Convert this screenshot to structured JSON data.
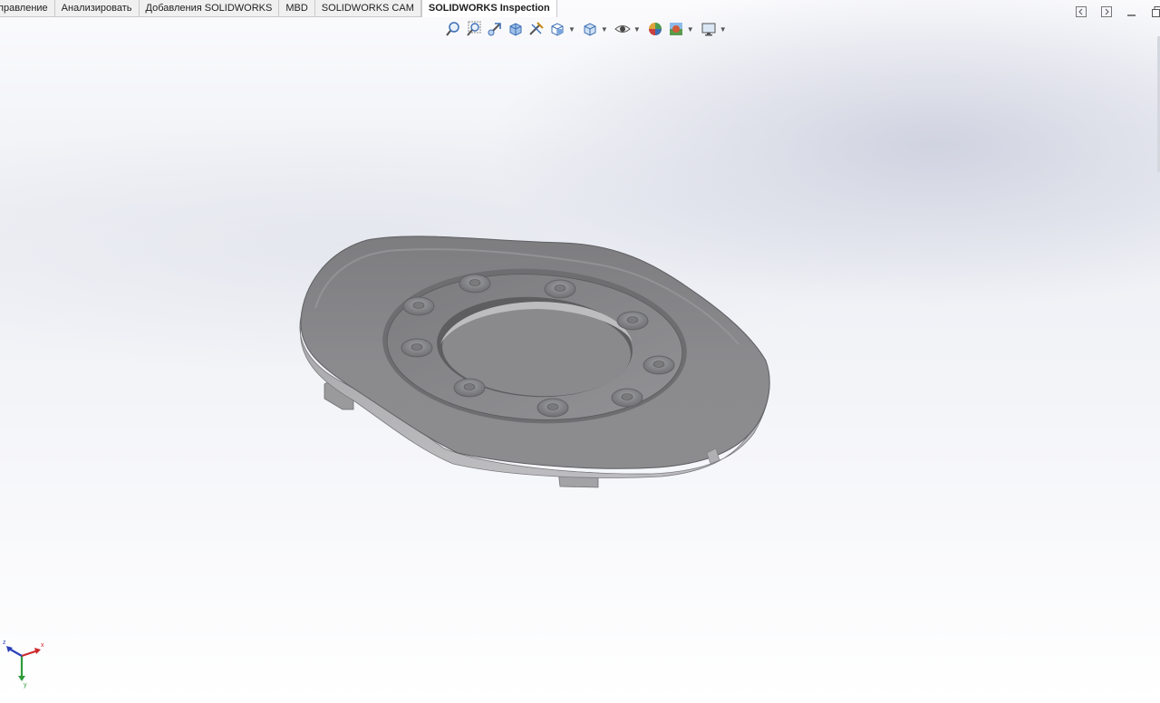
{
  "tabs": [
    {
      "label": "правление",
      "active": false
    },
    {
      "label": "Анализировать",
      "active": false
    },
    {
      "label": "Добавления SOLIDWORKS",
      "active": false
    },
    {
      "label": "MBD",
      "active": false
    },
    {
      "label": "SOLIDWORKS CAM",
      "active": false
    },
    {
      "label": "SOLIDWORKS Inspection",
      "active": true
    }
  ],
  "heads_up_toolbar": {
    "icons": [
      "zoom-to-fit-icon",
      "zoom-to-area-icon",
      "previous-view-icon",
      "section-view-icon",
      "dynamic-annotation-icon",
      "view-orientation-icon",
      "display-style-icon",
      "hide-show-items-icon",
      "edit-appearance-icon",
      "apply-scene-icon",
      "view-settings-icon"
    ]
  },
  "triad": {
    "x_label": "x",
    "y_label": "y",
    "z_label": "z"
  },
  "colors": {
    "part": "#8a8a8c",
    "background": "#f3f4f8"
  }
}
